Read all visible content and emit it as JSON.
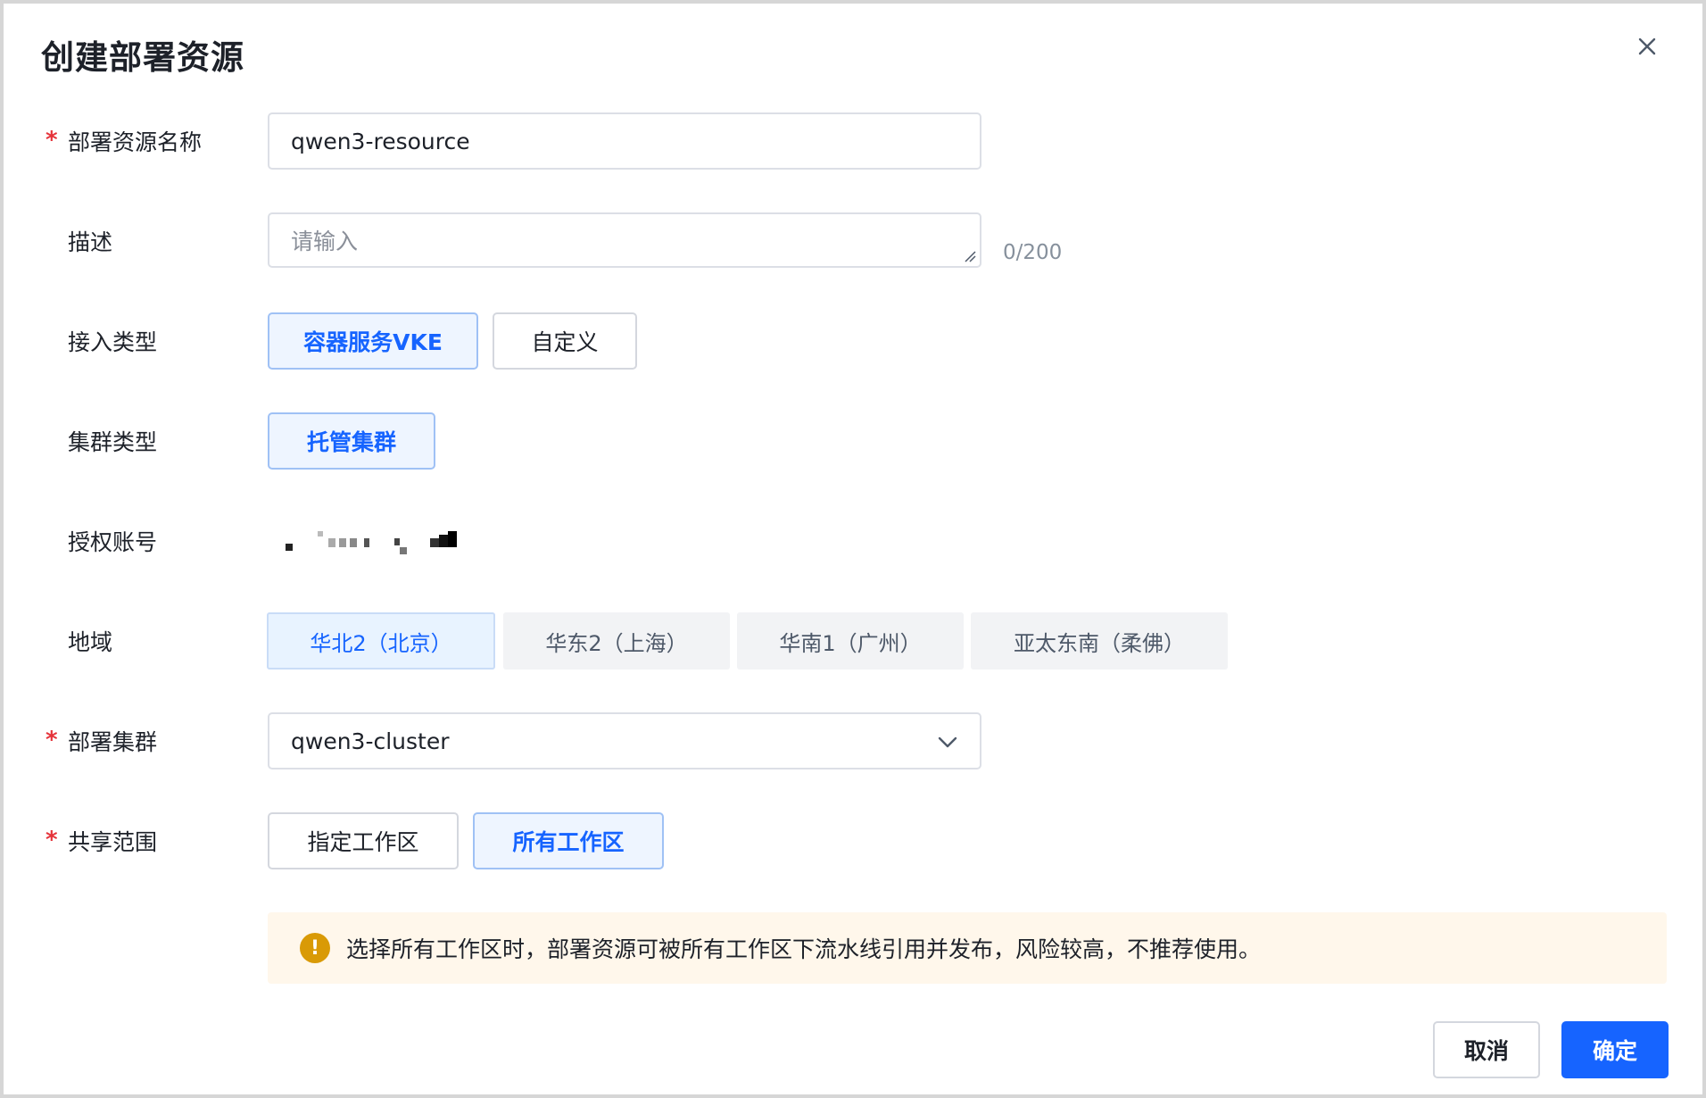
{
  "dialog": {
    "title": "创建部署资源",
    "close_icon": "close-icon"
  },
  "form": {
    "name": {
      "label": "部署资源名称",
      "required": true,
      "value": "qwen3-resource"
    },
    "description": {
      "label": "描述",
      "placeholder": "请输入",
      "counter": "0/200"
    },
    "access_type": {
      "label": "接入类型",
      "options": [
        "容器服务VKE",
        "自定义"
      ],
      "selected": "容器服务VKE"
    },
    "cluster_type": {
      "label": "集群类型",
      "options": [
        "托管集群"
      ],
      "selected": "托管集群"
    },
    "account": {
      "label": "授权账号"
    },
    "region": {
      "label": "地域",
      "options": [
        "华北2（北京）",
        "华东2（上海）",
        "华南1（广州）",
        "亚太东南（柔佛）"
      ],
      "selected": "华北2（北京）"
    },
    "cluster": {
      "label": "部署集群",
      "required": true,
      "value": "qwen3-cluster",
      "arrow_icon": "chevron-down-icon"
    },
    "share_scope": {
      "label": "共享范围",
      "required": true,
      "options": [
        "指定工作区",
        "所有工作区"
      ],
      "selected": "所有工作区"
    }
  },
  "alert": {
    "icon": "warning-icon",
    "text": "选择所有工作区时，部署资源可被所有工作区下流水线引用并发布，风险较高，不推荐使用。"
  },
  "footer": {
    "cancel_label": "取消",
    "ok_label": "确定"
  },
  "colors": {
    "primary": "#1664ff",
    "required": "#e5333a",
    "warning": "#d99a06",
    "alert_bg": "#fff7eb"
  }
}
